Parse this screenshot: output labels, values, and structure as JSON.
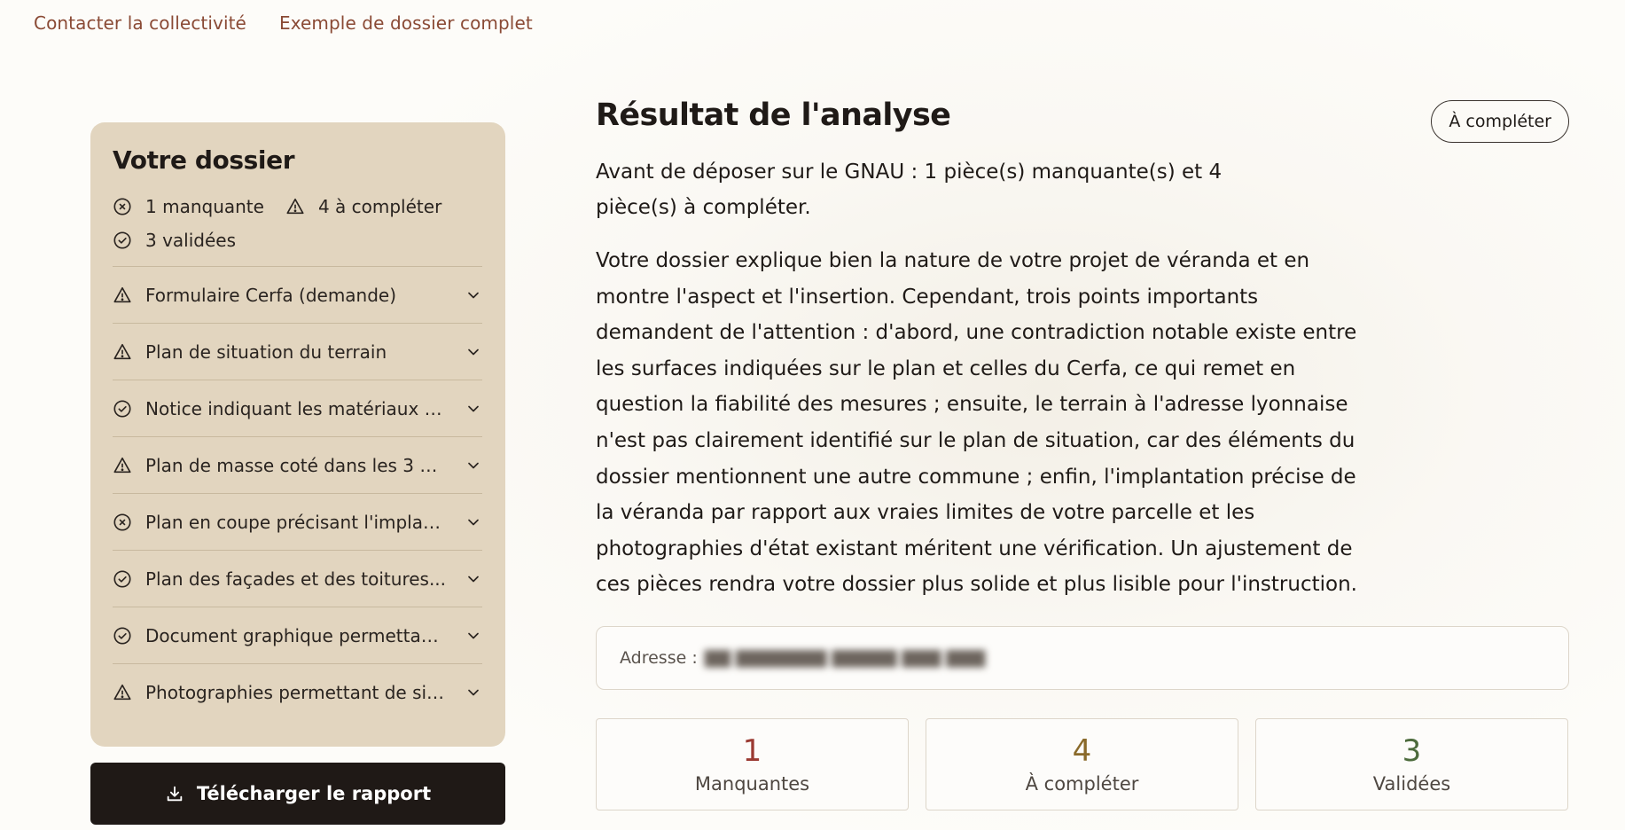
{
  "nav": {
    "contact": "Contacter la collectivité",
    "example": "Exemple de dossier complet"
  },
  "dossier": {
    "title": "Votre dossier",
    "stats": {
      "missing": "1 manquante",
      "to_complete": "4 à compléter",
      "validated": "3 validées"
    },
    "items": [
      {
        "label": "Formulaire Cerfa (demande)",
        "status": "warning",
        "icon": "warning-icon"
      },
      {
        "label": "Plan de situation du terrain",
        "status": "warning",
        "icon": "warning-icon"
      },
      {
        "label": "Notice indiquant les matériaux u...",
        "status": "validated",
        "icon": "check-circle-icon"
      },
      {
        "label": "Plan de masse coté dans les 3 di...",
        "status": "warning",
        "icon": "warning-icon"
      },
      {
        "label": "Plan en coupe précisant l'implan...",
        "status": "missing",
        "icon": "x-circle-icon"
      },
      {
        "label": "Plan des façades et des toitures...",
        "status": "validated",
        "icon": "check-circle-icon"
      },
      {
        "label": "Document graphique permettan...",
        "status": "validated",
        "icon": "check-circle-icon"
      },
      {
        "label": "Photographies permettant de sit...",
        "status": "warning",
        "icon": "warning-icon"
      }
    ]
  },
  "download": {
    "label": "Télécharger le rapport",
    "icon": "download-icon"
  },
  "result": {
    "title": "Résultat de l'analyse",
    "status": "À compléter",
    "summary": "Avant de déposer sur le GNAU : 1 pièce(s) manquante(s) et 4 pièce(s) à compléter.",
    "body": "Votre dossier explique bien la nature de votre projet de véranda et en montre l'aspect et l'insertion. Cependant, trois points importants demandent de l'attention : d'abord, une contradiction notable existe entre les surfaces indiquées sur le plan et celles du Cerfa, ce qui remet en question la fiabilité des mesures ; ensuite, le terrain à l'adresse lyonnaise n'est pas clairement identifié sur le plan de situation, car des éléments du dossier mentionnent une autre commune ; enfin, l'implantation précise de la véranda par rapport aux vraies limites de votre parcelle et les photographies d'état existant méritent une vérification. Un ajustement de ces pièces rendra votre dossier plus solide et plus lisible pour l'instruction.",
    "address_label": "Adresse :"
  },
  "counts": [
    {
      "value": "1",
      "label": "Manquantes",
      "color": "#9b3a32"
    },
    {
      "value": "4",
      "label": "À compléter",
      "color": "#8a6a2a"
    },
    {
      "value": "3",
      "label": "Validées",
      "color": "#4d6b3c"
    }
  ]
}
